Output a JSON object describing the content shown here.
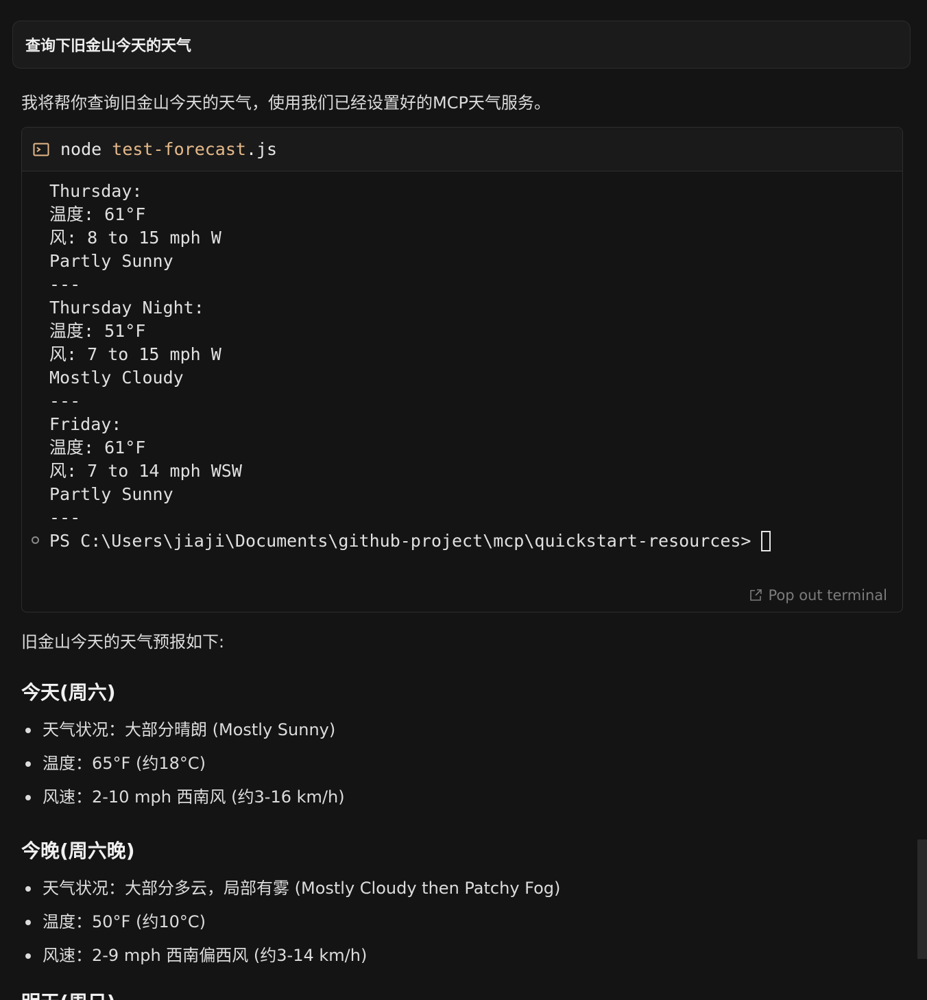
{
  "user_message": "查询下旧金山今天的天气",
  "assistant_intro": "我将帮你查询旧金山今天的天气，使用我们已经设置好的MCP天气服务。",
  "terminal": {
    "icon": "terminal-icon",
    "command": "node",
    "command_arg": "test-forecast",
    "command_ext": ".js",
    "output_lines": [
      "Thursday:",
      "温度: 61°F",
      "风: 8 to 15 mph W",
      "Partly Sunny",
      "---",
      "Thursday Night:",
      "温度: 51°F",
      "风: 7 to 15 mph W",
      "Mostly Cloudy",
      "---",
      "Friday:",
      "温度: 61°F",
      "风: 7 to 14 mph WSW",
      "Partly Sunny",
      "---"
    ],
    "prompt": "PS C:\\Users\\jiaji\\Documents\\github-project\\mcp\\quickstart-resources>",
    "pop_out_label": "Pop out terminal"
  },
  "forecast_intro": "旧金山今天的天气预报如下:",
  "sections": [
    {
      "title": "今天(周六)",
      "items": [
        "天气状况：大部分晴朗 (Mostly Sunny)",
        "温度：65°F (约18°C)",
        "风速：2-10 mph 西南风 (约3-16 km/h)"
      ]
    },
    {
      "title": "今晚(周六晚)",
      "items": [
        "天气状况：大部分多云，局部有雾 (Mostly Cloudy then Patchy Fog)",
        "温度：50°F (约10°C)",
        "风速：2-9 mph 西南偏西风 (约3-14 km/h)"
      ]
    }
  ],
  "next_section_title": "明天(周日)"
}
